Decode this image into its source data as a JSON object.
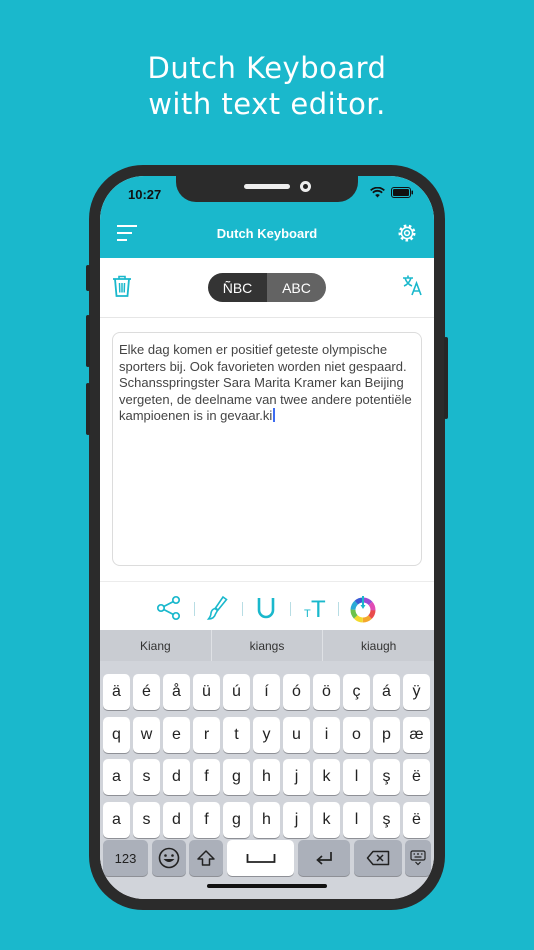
{
  "headline": {
    "line1": "Dutch Keyboard",
    "line2": "with text editor."
  },
  "status_bar": {
    "time": "10:27"
  },
  "nav": {
    "title": "Dutch Keyboard"
  },
  "toolbar": {
    "mode_special": "ÑBC",
    "mode_normal": "ABC"
  },
  "editor": {
    "text": "Elke dag komen er positief geteste olympische sporters bij. Ook favorieten worden niet gespaard. Schansspringster Sara Marita Kramer kan Beijing vergeten, de deelname van twee andere potentiële kampioenen is in gevaar.ki"
  },
  "format_bar": {
    "font_size_label": "T"
  },
  "keyboard": {
    "suggestions": [
      "Kiang",
      "kiangs",
      "kiaugh"
    ],
    "rows": [
      [
        "ä",
        "é",
        "å",
        "ü",
        "ú",
        "í",
        "ó",
        "ö",
        "ç",
        "á",
        "ÿ"
      ],
      [
        "q",
        "w",
        "e",
        "r",
        "t",
        "y",
        "u",
        "i",
        "o",
        "p",
        "æ"
      ],
      [
        "a",
        "s",
        "d",
        "f",
        "g",
        "h",
        "j",
        "k",
        "l",
        "ş",
        "ë"
      ],
      [
        "a",
        "s",
        "d",
        "f",
        "g",
        "h",
        "j",
        "k",
        "l",
        "ş",
        "ë"
      ]
    ],
    "numbers_label": "123"
  },
  "colors": {
    "accent": "#1ab8cc",
    "segment_active": "#343434",
    "segment_inactive": "#636363",
    "cursor": "#3d6cf0"
  }
}
